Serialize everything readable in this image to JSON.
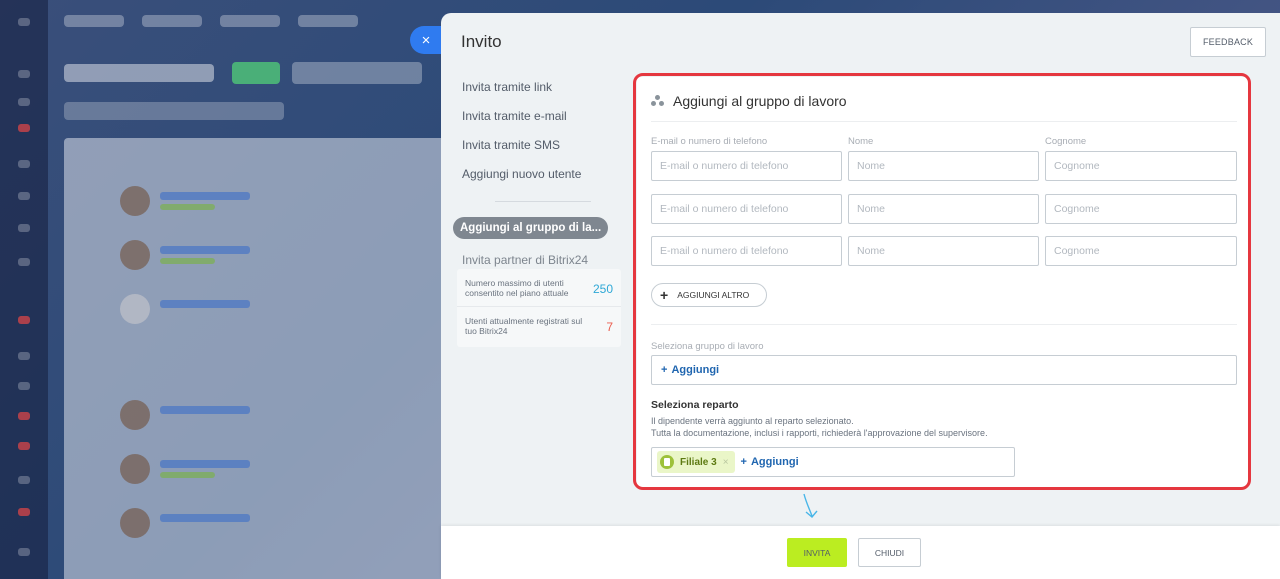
{
  "modal": {
    "title": "Invito",
    "feedback_label": "FEEDBACK",
    "close_glyph": "×"
  },
  "sidebar": {
    "items": [
      {
        "label": "Invita tramite link"
      },
      {
        "label": "Invita tramite e-mail"
      },
      {
        "label": "Invita tramite SMS"
      },
      {
        "label": "Aggiungi nuovo utente"
      }
    ],
    "active_label": "Aggiungi al gruppo di la...",
    "partner_label": "Invita partner di Bitrix24",
    "limits": [
      {
        "text": "Numero massimo di utenti consentito nel piano attuale",
        "value": "250"
      },
      {
        "text": "Utenti attualmente registrati sul tuo Bitrix24",
        "value": "7"
      }
    ]
  },
  "panel": {
    "heading": "Aggiungi al gruppo di lavoro",
    "columns": {
      "email": "E-mail o numero di telefono",
      "name": "Nome",
      "surname": "Cognome"
    },
    "placeholders": {
      "email": "E-mail o numero di telefono",
      "name": "Nome",
      "surname": "Cognome"
    },
    "add_more_label": "AGGIUNGI ALTRO",
    "workgroup": {
      "label": "Seleziona gruppo di lavoro",
      "add_label": "Aggiungi"
    },
    "department": {
      "title": "Seleziona reparto",
      "desc_line1": "Il dipendente verrà aggiunto al reparto selezionato.",
      "desc_line2": "Tutta la documentazione, inclusi i rapporti, richiederà l'approvazione del supervisore.",
      "chip_label": "Filiale 3",
      "add_label": "Aggiungi"
    }
  },
  "footer": {
    "invite_label": "INVITA",
    "close_label": "CHIUDI"
  },
  "colors": {
    "accent_green": "#bbed21",
    "highlight_red": "#e5373f",
    "link_blue": "#2066b0",
    "close_blue": "#2f7bf0"
  }
}
